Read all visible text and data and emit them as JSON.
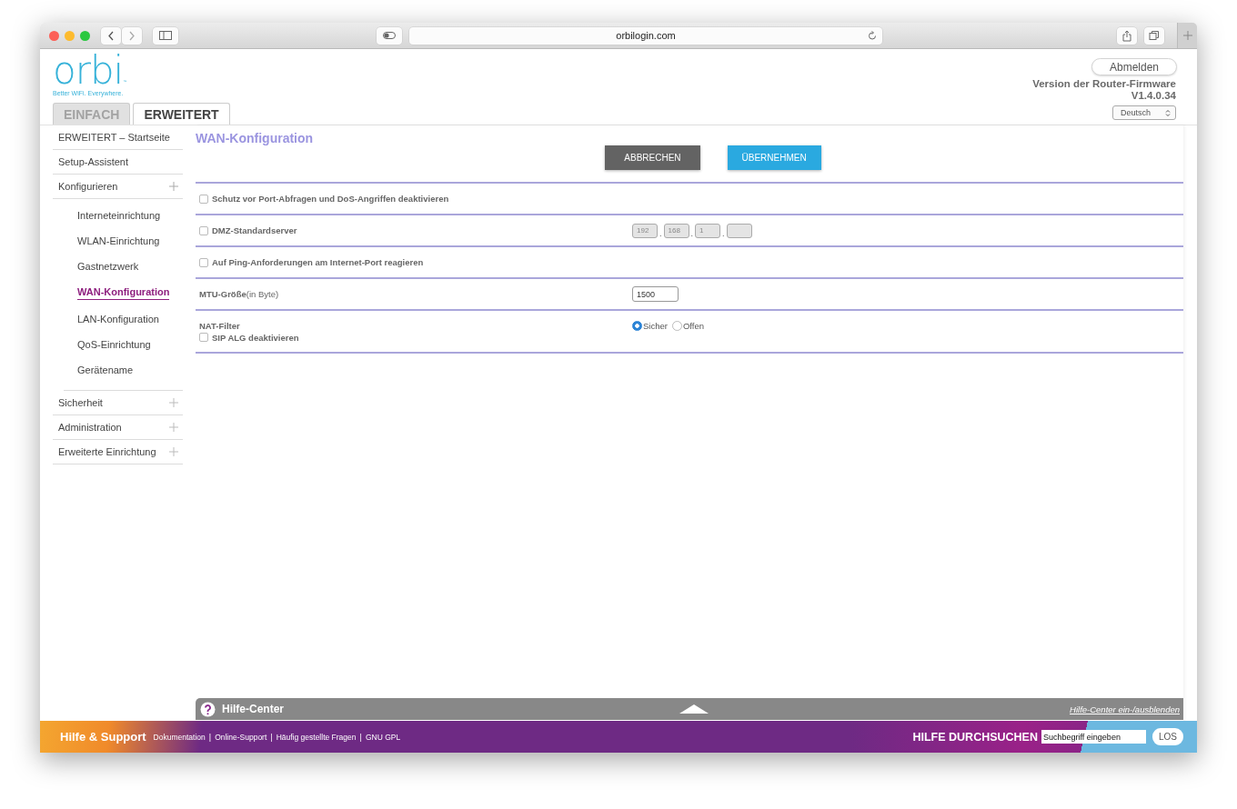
{
  "browser": {
    "url": "orbilogin.com"
  },
  "header": {
    "logo": "orbi",
    "trademark": "™",
    "tagline": "Better WiFi. Everywhere.",
    "logout": "Abmelden",
    "firmware_label": "Version der Router-Firmware",
    "firmware_version": "V1.4.0.34",
    "language": "Deutsch"
  },
  "tabs": [
    {
      "label": "EINFACH",
      "selected": false
    },
    {
      "label": "ERWEITERT",
      "selected": true
    }
  ],
  "sidebar": {
    "items": [
      {
        "label": "ERWEITERT – Startseite",
        "kind": "link"
      },
      {
        "label": "Setup-Assistent",
        "kind": "link"
      },
      {
        "label": "Konfigurieren",
        "kind": "group",
        "expanded": true,
        "children": [
          {
            "label": "Interneteinrichtung",
            "selected": false
          },
          {
            "label": "WLAN-Einrichtung",
            "selected": false
          },
          {
            "label": "Gastnetzwerk",
            "selected": false
          },
          {
            "label": "WAN-Konfiguration",
            "selected": true
          },
          {
            "label": "LAN-Konfiguration",
            "selected": false
          },
          {
            "label": "QoS-Einrichtung",
            "selected": false
          },
          {
            "label": "Gerätename",
            "selected": false
          }
        ]
      },
      {
        "label": "Sicherheit",
        "kind": "group",
        "expanded": false
      },
      {
        "label": "Administration",
        "kind": "group",
        "expanded": false
      },
      {
        "label": "Erweiterte Einrichtung",
        "kind": "group",
        "expanded": false
      }
    ]
  },
  "main": {
    "title": "WAN-Konfiguration",
    "buttons": [
      {
        "label": "ABBRECHEN",
        "kind": "cancel"
      },
      {
        "label": "ÜBERNEHMEN",
        "kind": "apply"
      }
    ],
    "rows": [
      {
        "kind": "checkbox",
        "label": "Schutz vor Port-Abfragen und DoS-Angriffen deaktivieren",
        "checked": false
      },
      {
        "kind": "checkbox_ip",
        "label": "DMZ-Standardserver",
        "checked": false,
        "ip_separator": ".",
        "ip_fields": [
          {
            "placeholder": "192",
            "disabled": true
          },
          {
            "placeholder": "168",
            "disabled": true
          },
          {
            "placeholder": "1",
            "disabled": true
          },
          {
            "disabled": true
          }
        ]
      },
      {
        "kind": "checkbox",
        "label": "Auf Ping-Anforderungen am Internet-Port reagieren",
        "checked": false
      },
      {
        "kind": "text_input",
        "label": "**MTU-Größe**(in Byte)",
        "value": "1500"
      },
      {
        "kind": "nat",
        "label": "NAT-Filter",
        "options": [
          {
            "label": "Sicher",
            "selected": true
          },
          {
            "label": "Offen",
            "selected": false
          }
        ],
        "checkbox": {
          "label": "SIP ALG deaktivieren",
          "checked": false
        }
      }
    ]
  },
  "help_bar": {
    "title": "Hilfe-Center",
    "toggle": "Hilfe-Center ein-/ausblenden"
  },
  "footer": {
    "title": "Hilfe & Support",
    "separator": "|",
    "links": [
      "Dokumentation",
      "Online-Support",
      "Häufig gestellte Fragen",
      "GNU GPL"
    ],
    "search_label": "HILFE DURCHSUCHEN",
    "search_value": "Suchbegriff eingeben",
    "search_button": "LOS"
  }
}
